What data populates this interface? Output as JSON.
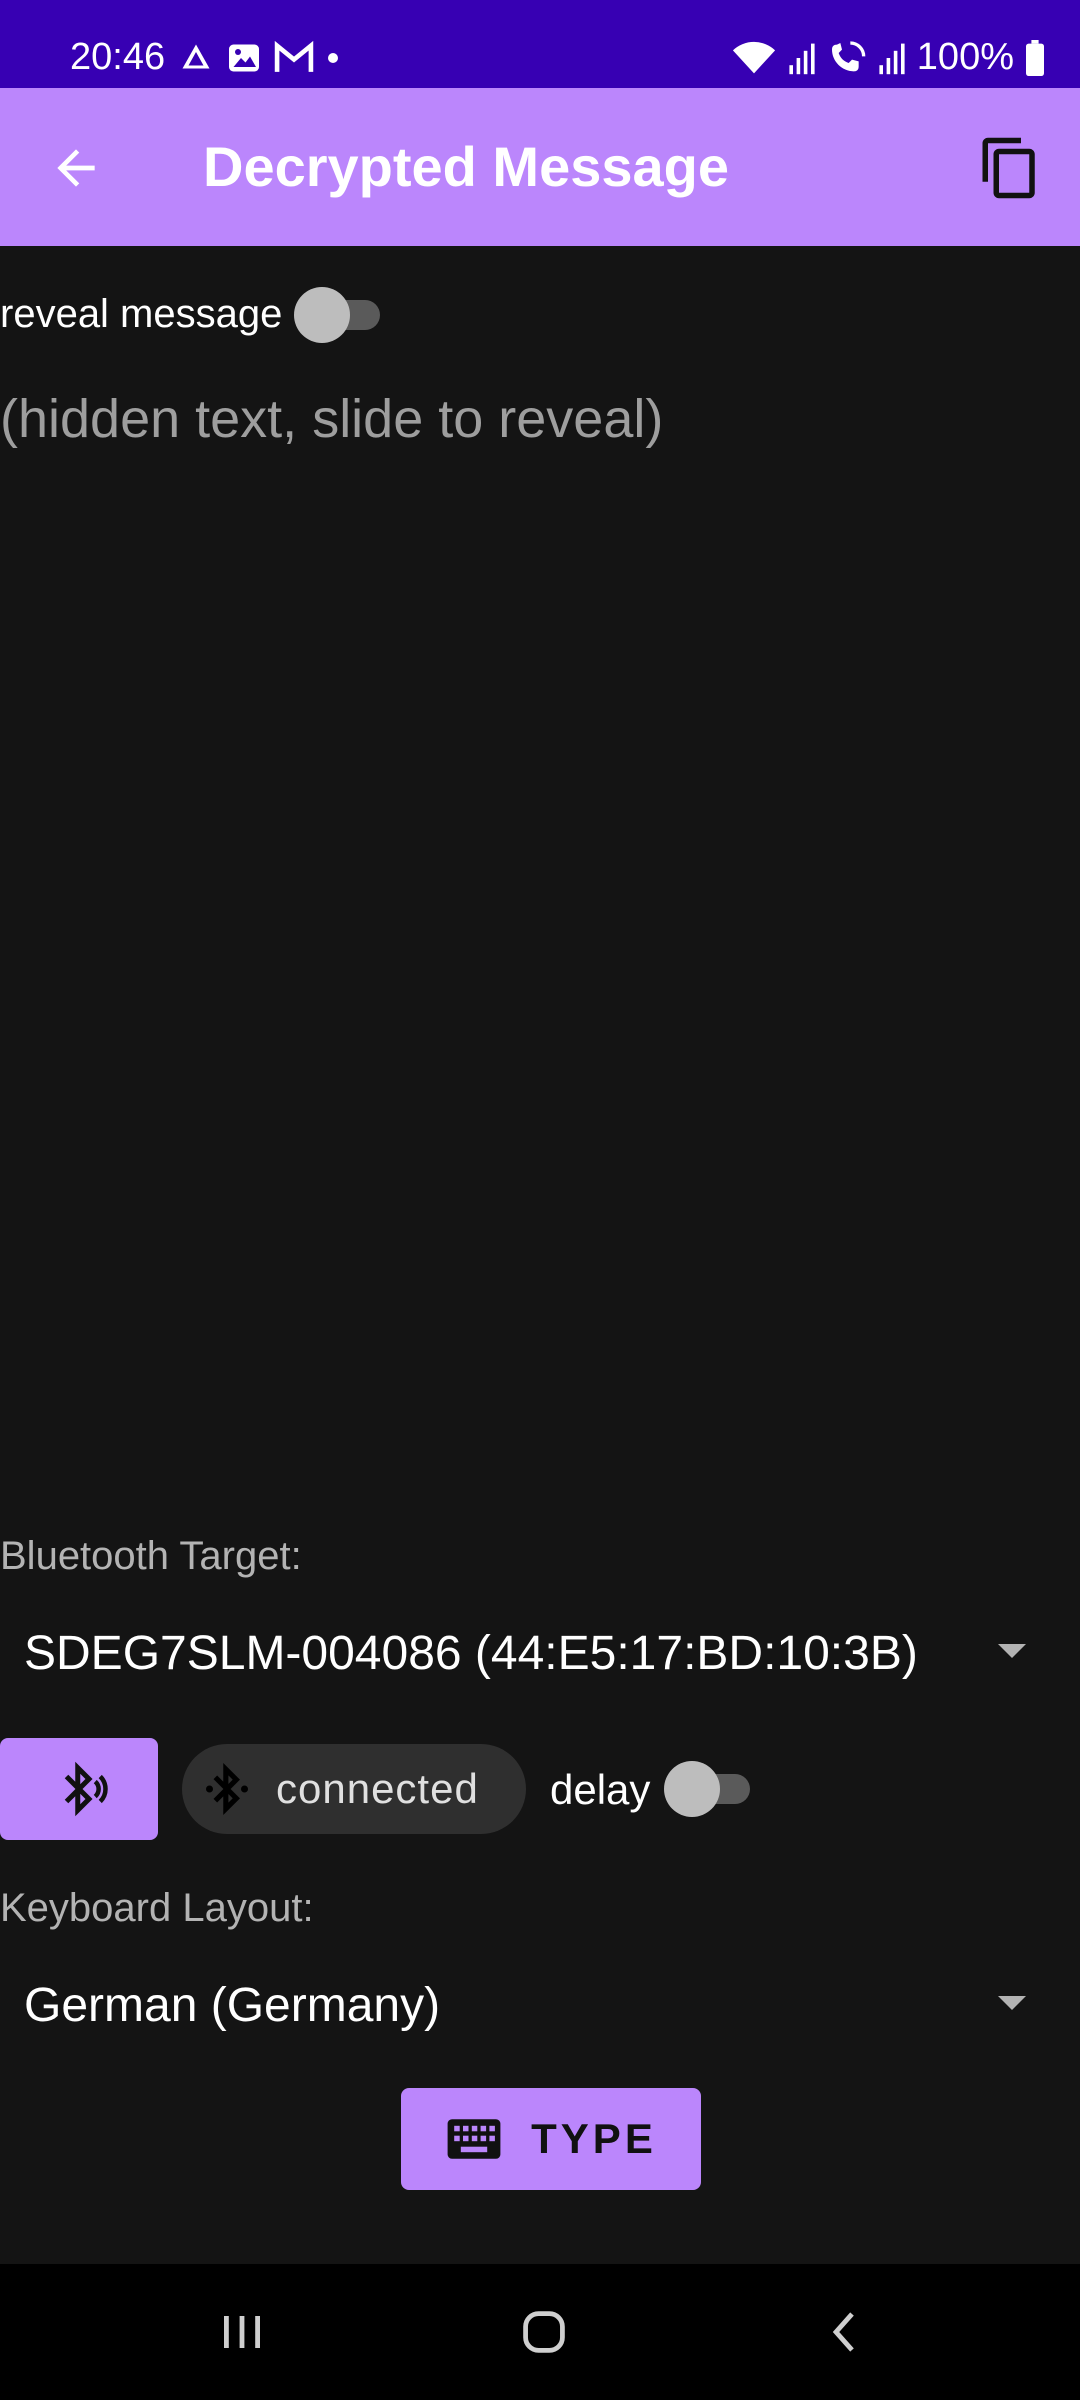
{
  "status_bar": {
    "time": "20:46",
    "battery_percent": "100%",
    "left_icons": [
      "drive-icon",
      "gallery-icon",
      "gmail-icon",
      "notification-dot-icon"
    ],
    "right_icons": [
      "wifi-icon",
      "signal-icon",
      "wifi-calling-icon",
      "signal-icon-2",
      "battery-icon"
    ]
  },
  "app_bar": {
    "title": "Decrypted Message",
    "back_icon": "arrow-back-icon",
    "copy_icon": "copy-icon"
  },
  "reveal": {
    "label": "reveal message",
    "enabled": false
  },
  "message": {
    "placeholder_text": "(hidden text, slide to reveal)"
  },
  "bluetooth": {
    "label": "Bluetooth Target:",
    "selected_device": "SDEG7SLM-004086 (44:E5:17:BD:10:3B)",
    "status": "connected",
    "delay_label": "delay",
    "delay_enabled": false
  },
  "keyboard": {
    "label": "Keyboard Layout:",
    "selected_layout": "German (Germany)"
  },
  "type_button": {
    "label": "TYPE"
  },
  "colors": {
    "status_bar": "#3700b3",
    "accent": "#bb86fc",
    "background": "#141414"
  }
}
